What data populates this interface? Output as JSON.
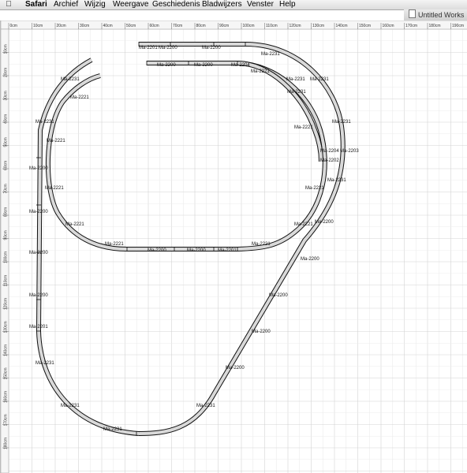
{
  "menubar": {
    "apple_icon": "apple-icon",
    "items": [
      "Safari",
      "Archief",
      "Wijzig",
      "Weergave",
      "Geschiedenis",
      "Bladwijzers",
      "Venster",
      "Help"
    ]
  },
  "window": {
    "title": "Untitled Works",
    "icon": "document-icon"
  },
  "ruler": {
    "top": [
      "0cm",
      "10cm",
      "20cm",
      "30cm",
      "40cm",
      "50cm",
      "60cm",
      "70cm",
      "80cm",
      "90cm",
      "100cm",
      "110cm",
      "120cm",
      "130cm",
      "140cm",
      "150cm",
      "160cm",
      "170cm",
      "180cm",
      "190cm"
    ],
    "left": [
      "10cm",
      "20cm",
      "30cm",
      "40cm",
      "50cm",
      "60cm",
      "70cm",
      "80cm",
      "90cm",
      "100cm",
      "110cm",
      "120cm",
      "130cm",
      "140cm",
      "150cm",
      "160cm",
      "170cm",
      "180cm"
    ]
  },
  "track_labels": [
    "Ma-2201",
    "Ma-2200",
    "Ma-2200",
    "Ma-2231",
    "Ma-2200",
    "Ma-2200",
    "Ma-2204",
    "Ma-2221",
    "Ma-2231",
    "Ma-2231",
    "Ma-2221",
    "Ma-2231",
    "Ma-2231",
    "Ma-2221",
    "Ma-2231",
    "Ma-2231",
    "Ma-2221",
    "Ma-2204",
    "Ma-2203",
    "Ma-2202",
    "Ma-2200",
    "Ma-2221",
    "Ma-2231",
    "Ma-2221",
    "Ma-2200",
    "Ma-2221",
    "Ma-2200",
    "Ma-2221",
    "Ma-2200",
    "Ma-2221",
    "Ma-2200",
    "Ma-2200",
    "Ma-2201",
    "Ma-2221",
    "Ma-2200",
    "Ma-2200",
    "Ma-2200",
    "Ma-2201",
    "Ma-2200",
    "Ma-2200",
    "Ma-2231",
    "Ma-2231",
    "Ma-2231",
    "Ma-2231"
  ]
}
